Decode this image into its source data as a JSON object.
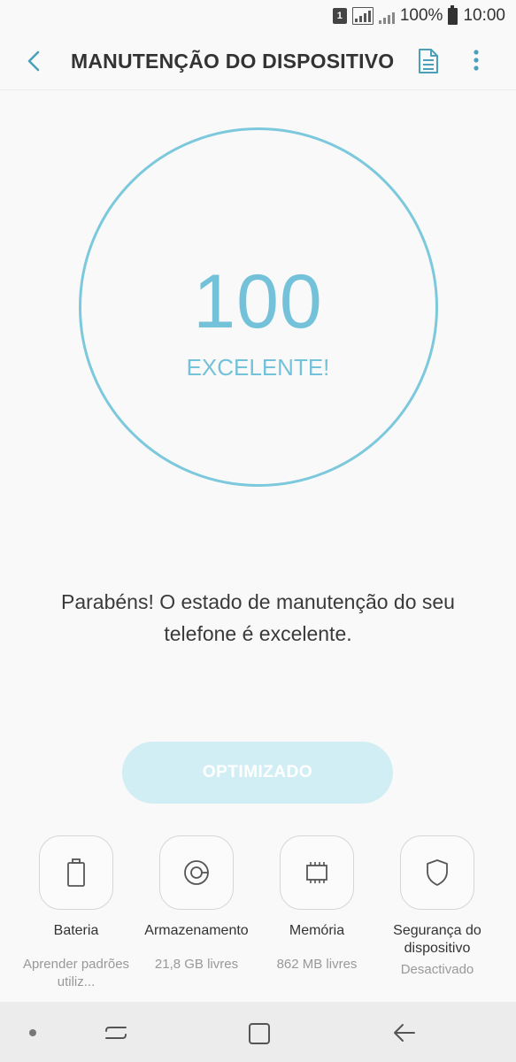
{
  "status_bar": {
    "sim": "1",
    "battery": "100%",
    "time": "10:00"
  },
  "app_bar": {
    "title": "MANUTENÇÃO DO DISPOSITIVO",
    "icons": [
      "back-arrow-icon",
      "document-icon",
      "more-vert-icon"
    ]
  },
  "score": {
    "value": "100",
    "label": "EXCELENTE!",
    "ring_color": "#7cc8dc"
  },
  "message": "Parabéns! O estado de manutenção do seu telefone é excelente.",
  "optimize_button": {
    "label": "OPTIMIZADO",
    "color": "#d2eef5"
  },
  "tiles": [
    {
      "label": "Bateria",
      "sub": "Aprender padrões utiliz...",
      "icon": "battery-icon"
    },
    {
      "label": "Armazenamento",
      "sub": "21,8 GB livres",
      "icon": "storage-icon"
    },
    {
      "label": "Memória",
      "sub": "862 MB livres",
      "icon": "memory-chip-icon"
    },
    {
      "label": "Segurança do dispositivo",
      "sub": "Desactivado",
      "icon": "shield-icon"
    }
  ],
  "nav_bar": {
    "icons": [
      "dot-icon",
      "recents-icon",
      "home-icon",
      "back-icon"
    ]
  }
}
